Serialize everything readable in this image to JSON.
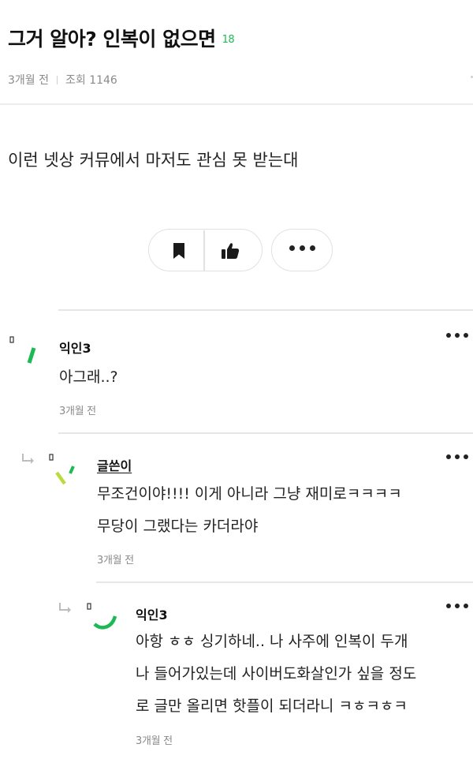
{
  "post": {
    "title": "그거 알아? 인복이 없으면",
    "comment_count": "18",
    "time": "3개월 전",
    "views": "조회 1146",
    "body": "이런 넷상 커뮤에서 마저도 관심 못 받는대"
  },
  "actions": {
    "bookmark_icon": "bookmark-icon",
    "like_icon": "thumbs-up-icon",
    "more_icon": "more-horizontal-icon"
  },
  "comments": [
    {
      "nickname": "익인3",
      "lines": [
        "아그래..?"
      ],
      "time": "3개월 전",
      "accent_color": "#1db954"
    },
    {
      "nickname": "글쓴이",
      "lines": [
        "무조건이야!!!! 이게 아니라 그냥 재미로ㅋㅋㅋㅋ",
        "무당이 그랬다는 카더라야"
      ],
      "time": "3개월 전",
      "accent_color": "#b8dc3c"
    },
    {
      "nickname": "익인3",
      "lines": [
        "아항 ㅎㅎ 싱기하네.. 나 사주에 인복이 두개",
        "나 들어가있는데 사이버도화살인가 싶을 정도",
        "로 글만 올리면 핫플이 되더라니 ㅋㅎㅋㅎㅋ"
      ],
      "time": "3개월 전",
      "accent_color": "#1db954"
    }
  ]
}
